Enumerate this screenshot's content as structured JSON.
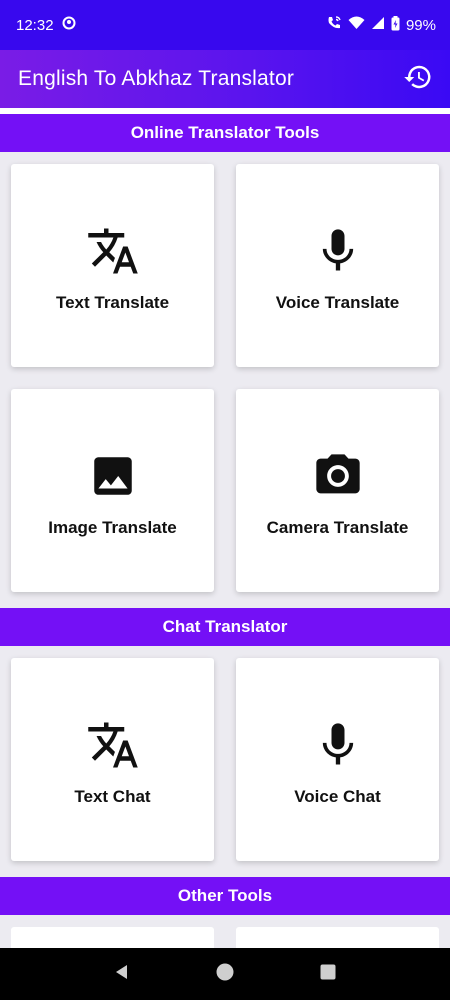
{
  "status_bar": {
    "time": "12:32",
    "battery": "99%",
    "icons": [
      "notification-circle-icon",
      "wifi-calling-icon",
      "wifi-icon",
      "cellular-signal-icon",
      "battery-icon"
    ]
  },
  "app_bar": {
    "title": "English To Abkhaz Translator",
    "action_icon": "history-icon"
  },
  "sections": [
    {
      "title": "Online Translator Tools",
      "cards": [
        {
          "label": "Text Translate",
          "icon": "translate-icon"
        },
        {
          "label": "Voice Translate",
          "icon": "mic-icon"
        },
        {
          "label": "Image Translate",
          "icon": "image-icon"
        },
        {
          "label": "Camera Translate",
          "icon": "camera-icon"
        }
      ]
    },
    {
      "title": "Chat Translator",
      "cards": [
        {
          "label": "Text Chat",
          "icon": "translate-icon"
        },
        {
          "label": "Voice Chat",
          "icon": "mic-icon"
        }
      ]
    },
    {
      "title": "Other Tools",
      "cards": []
    }
  ],
  "colors": {
    "status_bar": "#3808ee",
    "app_bar_start": "#7a1ce6",
    "app_bar_end": "#3a09f4",
    "section_header": "#7410f6",
    "background": "#ecebf1",
    "card": "#ffffff"
  },
  "nav_bar": {
    "icons": [
      "back-icon",
      "home-icon",
      "recents-icon"
    ]
  }
}
